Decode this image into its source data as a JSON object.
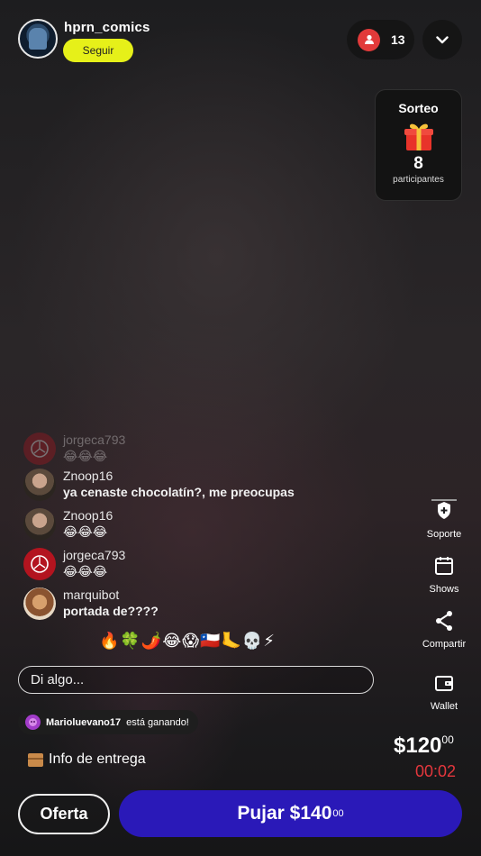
{
  "header": {
    "streamer_name": "hprn_comics",
    "follow_label": "Seguir",
    "viewer_count": "13"
  },
  "giveaway": {
    "title": "Sorteo",
    "count": "8",
    "label": "participantes"
  },
  "chat": {
    "messages": [
      {
        "user": "jorgeca793",
        "text": "😂😂😂"
      },
      {
        "user": "Znoop16",
        "text": "ya cenaste chocolatín?, me preocupas"
      },
      {
        "user": "Znoop16",
        "text": "😂😂😂"
      },
      {
        "user": "jorgeca793",
        "text": "😂😂😂"
      },
      {
        "user": "marquibot",
        "text": "portada de????"
      }
    ],
    "quick_emojis": "🔥🍀🌶️😂😱🇨🇱🦶💀⚡",
    "input_placeholder": "Di algo..."
  },
  "winner": {
    "name": "Marioluevano17",
    "status": "está ganando!"
  },
  "delivery_label": "Info de entrega",
  "side_actions": [
    {
      "label": "Soporte",
      "icon": "shield-plus-icon"
    },
    {
      "label": "Shows",
      "icon": "calendar-icon"
    },
    {
      "label": "Compartir",
      "icon": "share-icon"
    },
    {
      "label": "Wallet",
      "icon": "wallet-icon"
    }
  ],
  "auction": {
    "price_main": "$120",
    "price_cents": "00",
    "timer": "00:02"
  },
  "actions": {
    "offer_label": "Oferta",
    "bid_label": "Pujar $140",
    "bid_cents": "00"
  },
  "colors": {
    "follow": "#e6f019",
    "bid": "#2a19b8",
    "timer": "#e4373d",
    "viewer_badge": "#e23a3a"
  }
}
